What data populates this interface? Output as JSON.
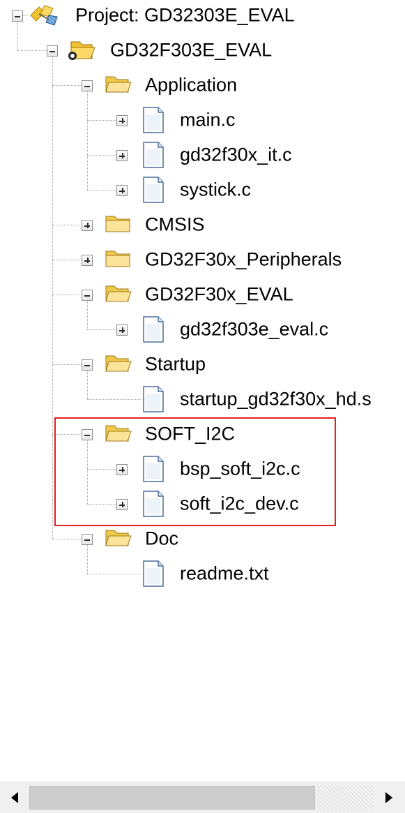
{
  "tree": {
    "root_label": "Project: GD32303E_EVAL",
    "target_label": "GD32F303E_EVAL",
    "groups": [
      {
        "label": "Application",
        "expanded": true,
        "files": [
          {
            "label": "main.c",
            "has_children": true
          },
          {
            "label": "gd32f30x_it.c",
            "has_children": true
          },
          {
            "label": "systick.c",
            "has_children": true
          }
        ]
      },
      {
        "label": "CMSIS",
        "expanded": false,
        "files": []
      },
      {
        "label": "GD32F30x_Peripherals",
        "expanded": false,
        "files": []
      },
      {
        "label": "GD32F30x_EVAL",
        "expanded": true,
        "files": [
          {
            "label": "gd32f303e_eval.c",
            "has_children": true
          }
        ]
      },
      {
        "label": "Startup",
        "expanded": true,
        "files": [
          {
            "label": "startup_gd32f30x_hd.s",
            "has_children": false
          }
        ]
      },
      {
        "label": "SOFT_I2C",
        "expanded": true,
        "highlighted": true,
        "files": [
          {
            "label": "bsp_soft_i2c.c",
            "has_children": true
          },
          {
            "label": "soft_i2c_dev.c",
            "has_children": true
          }
        ]
      },
      {
        "label": "Doc",
        "expanded": true,
        "files": [
          {
            "label": "readme.txt",
            "has_children": false
          }
        ]
      }
    ]
  },
  "icons": {
    "root": "project-icon",
    "target": "target-folder-icon",
    "group_open": "folder-open-icon",
    "group_closed": "folder-icon",
    "file": "file-icon"
  },
  "colors": {
    "highlight_border": "#e02020",
    "folder": "#f0c84a",
    "tree_line": "#a6a6a6"
  },
  "scrollbar": {
    "left_arrow": "◀",
    "right_arrow": "▶"
  }
}
